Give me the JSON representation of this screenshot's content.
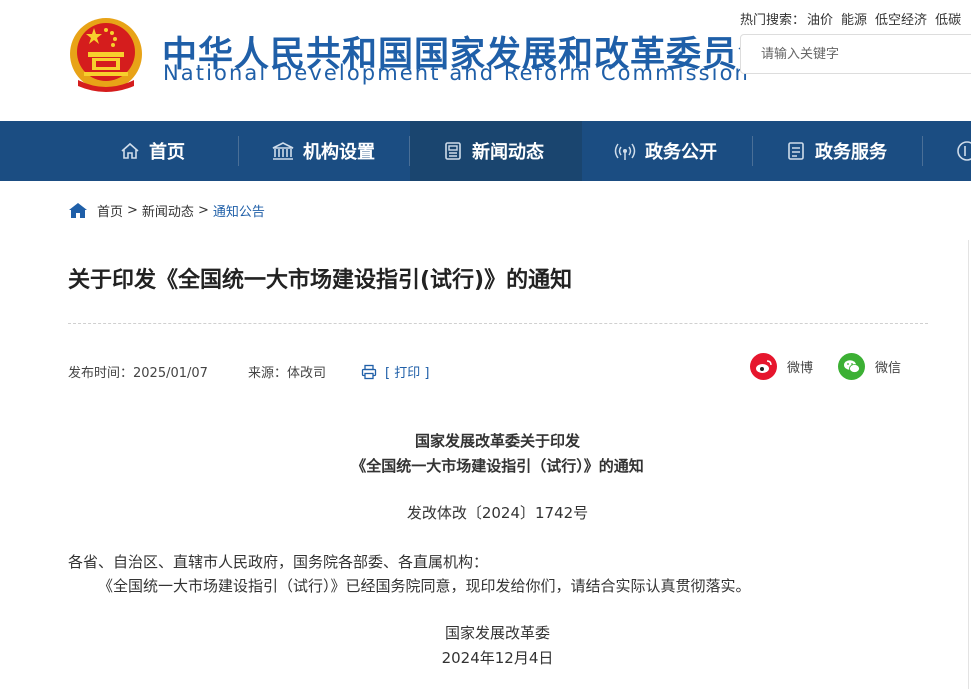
{
  "header": {
    "site_title_cn": "中华人民共和国国家发展和改革委员会",
    "site_title_en": "National Development and Reform Commission",
    "hot_label": "热门搜索：",
    "hot_keywords": [
      "油价",
      "能源",
      "低空经济",
      "低碳"
    ],
    "search_placeholder": "请输入关键字"
  },
  "nav": {
    "items": [
      {
        "label": "首页",
        "icon": "home-icon"
      },
      {
        "label": "机构设置",
        "icon": "institution-icon"
      },
      {
        "label": "新闻动态",
        "icon": "news-icon",
        "active": true
      },
      {
        "label": "政务公开",
        "icon": "broadcast-icon"
      },
      {
        "label": "政务服务",
        "icon": "service-icon"
      }
    ]
  },
  "breadcrumb": {
    "items": [
      "首页",
      "新闻动态",
      "通知公告"
    ],
    "separator": ">"
  },
  "article": {
    "title": "关于印发《全国统一大市场建设指引(试行)》的通知",
    "publish_time": "发布时间：2025/01/07",
    "source": "来源：体改司",
    "print_label": "[ 打印 ]",
    "share_weibo": "微博",
    "share_wechat": "微信"
  },
  "document": {
    "heading_line1": "国家发展改革委关于印发",
    "heading_line2": "《全国统一大市场建设指引（试行）》的通知",
    "doc_number": "发改体改〔2024〕1742号",
    "addressee": "各省、自治区、直辖市人民政府，国务院各部委、各直属机构：",
    "body": "《全国统一大市场建设指引（试行）》已经国务院同意，现印发给你们，请结合实际认真贯彻落实。",
    "signature": "国家发展改革委",
    "date": "2024年12月4日"
  },
  "colors": {
    "brand_blue": "#1f5fa8",
    "nav_bg": "#1b4d82",
    "nav_active": "#1a456f",
    "weibo_red": "#e6162d",
    "wechat_green": "#3cb034"
  }
}
